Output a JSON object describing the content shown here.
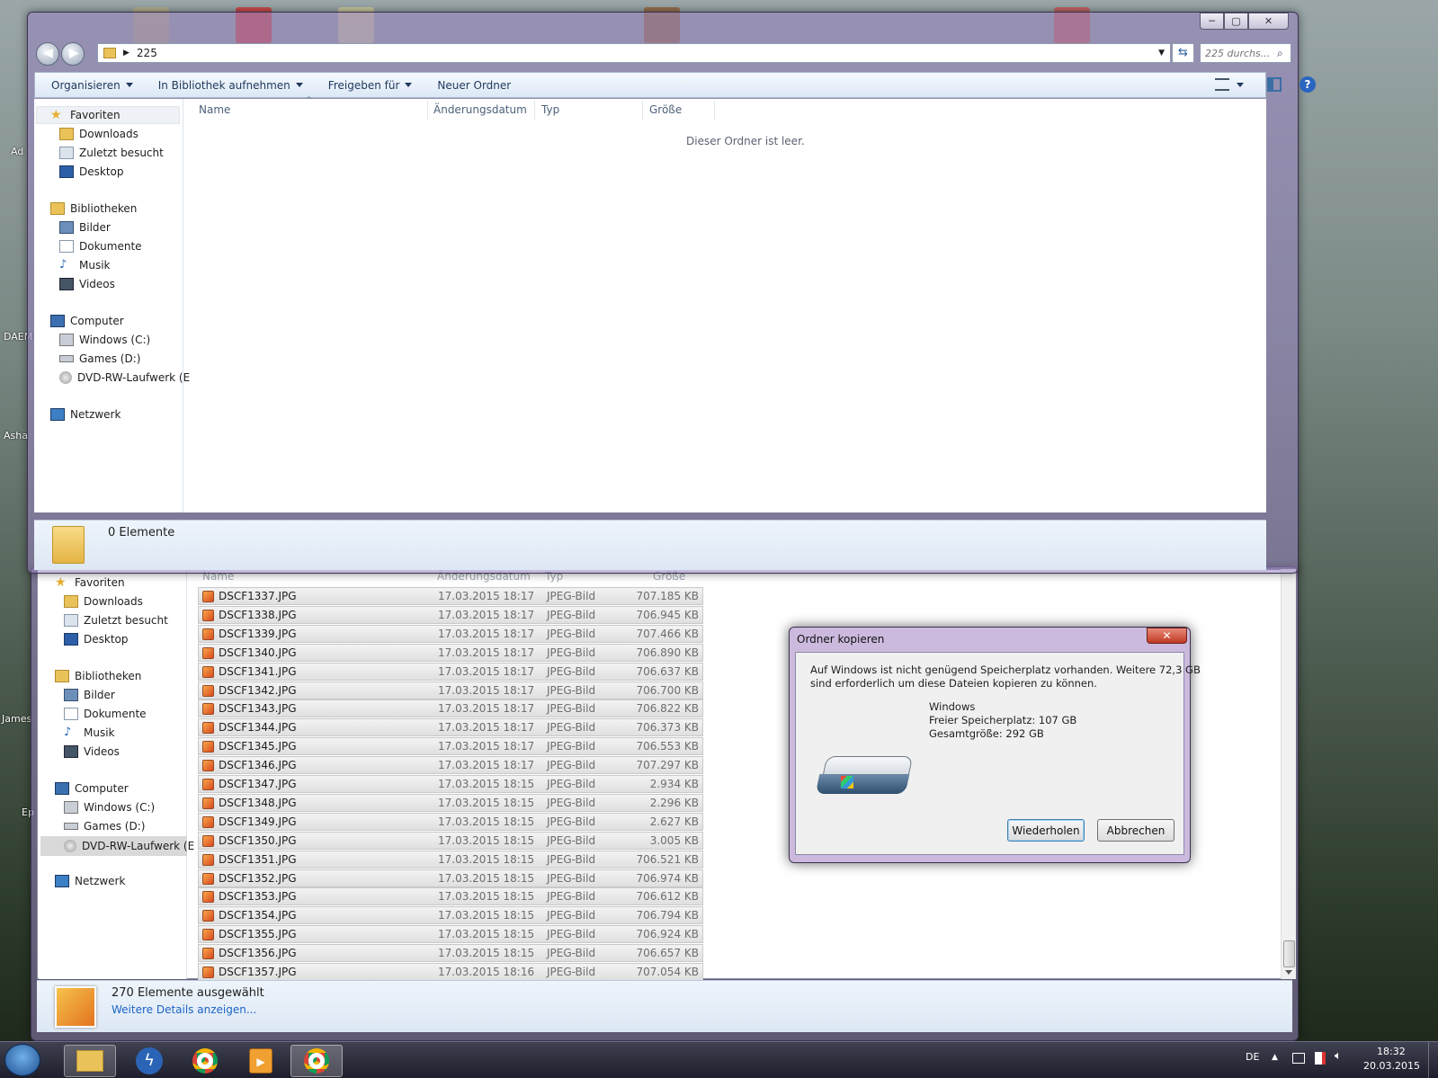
{
  "desktop": {
    "icons": [
      "Ad",
      "DAEM",
      "Asha",
      "James",
      "Ep"
    ]
  },
  "top_window": {
    "breadcrumb": "225",
    "search_placeholder": "225 durchs...",
    "toolbar": {
      "organize": "Organisieren",
      "library": "In Bibliothek aufnehmen",
      "share": "Freigeben für",
      "new_folder": "Neuer Ordner"
    },
    "columns": {
      "name": "Name",
      "date": "Änderungsdatum",
      "type": "Typ",
      "size": "Größe"
    },
    "empty_message": "Dieser Ordner ist leer.",
    "status": "0 Elemente"
  },
  "nav": {
    "favorites": "Favoriten",
    "downloads": "Downloads",
    "recent": "Zuletzt besucht",
    "desktop": "Desktop",
    "libraries": "Bibliotheken",
    "pictures": "Bilder",
    "documents": "Dokumente",
    "music": "Musik",
    "videos": "Videos",
    "computer": "Computer",
    "drive_c": "Windows (C:)",
    "drive_d": "Games (D:)",
    "drive_e": "DVD-RW-Laufwerk (E",
    "network": "Netzwerk"
  },
  "bottom_window": {
    "columns": {
      "name": "Name",
      "date": "Änderungsdatum",
      "type": "Typ",
      "size": "Größe"
    },
    "files": [
      {
        "name": "DSCF1337.JPG",
        "date": "17.03.2015 18:17",
        "type": "JPEG-Bild",
        "size": "707.185 KB"
      },
      {
        "name": "DSCF1338.JPG",
        "date": "17.03.2015 18:17",
        "type": "JPEG-Bild",
        "size": "706.945 KB"
      },
      {
        "name": "DSCF1339.JPG",
        "date": "17.03.2015 18:17",
        "type": "JPEG-Bild",
        "size": "707.466 KB"
      },
      {
        "name": "DSCF1340.JPG",
        "date": "17.03.2015 18:17",
        "type": "JPEG-Bild",
        "size": "706.890 KB"
      },
      {
        "name": "DSCF1341.JPG",
        "date": "17.03.2015 18:17",
        "type": "JPEG-Bild",
        "size": "706.637 KB"
      },
      {
        "name": "DSCF1342.JPG",
        "date": "17.03.2015 18:17",
        "type": "JPEG-Bild",
        "size": "706.700 KB"
      },
      {
        "name": "DSCF1343.JPG",
        "date": "17.03.2015 18:17",
        "type": "JPEG-Bild",
        "size": "706.822 KB"
      },
      {
        "name": "DSCF1344.JPG",
        "date": "17.03.2015 18:17",
        "type": "JPEG-Bild",
        "size": "706.373 KB"
      },
      {
        "name": "DSCF1345.JPG",
        "date": "17.03.2015 18:17",
        "type": "JPEG-Bild",
        "size": "706.553 KB"
      },
      {
        "name": "DSCF1346.JPG",
        "date": "17.03.2015 18:17",
        "type": "JPEG-Bild",
        "size": "707.297 KB"
      },
      {
        "name": "DSCF1347.JPG",
        "date": "17.03.2015 18:15",
        "type": "JPEG-Bild",
        "size": "2.934 KB"
      },
      {
        "name": "DSCF1348.JPG",
        "date": "17.03.2015 18:15",
        "type": "JPEG-Bild",
        "size": "2.296 KB"
      },
      {
        "name": "DSCF1349.JPG",
        "date": "17.03.2015 18:15",
        "type": "JPEG-Bild",
        "size": "2.627 KB"
      },
      {
        "name": "DSCF1350.JPG",
        "date": "17.03.2015 18:15",
        "type": "JPEG-Bild",
        "size": "3.005 KB"
      },
      {
        "name": "DSCF1351.JPG",
        "date": "17.03.2015 18:15",
        "type": "JPEG-Bild",
        "size": "706.521 KB"
      },
      {
        "name": "DSCF1352.JPG",
        "date": "17.03.2015 18:15",
        "type": "JPEG-Bild",
        "size": "706.974 KB"
      },
      {
        "name": "DSCF1353.JPG",
        "date": "17.03.2015 18:15",
        "type": "JPEG-Bild",
        "size": "706.612 KB"
      },
      {
        "name": "DSCF1354.JPG",
        "date": "17.03.2015 18:15",
        "type": "JPEG-Bild",
        "size": "706.794 KB"
      },
      {
        "name": "DSCF1355.JPG",
        "date": "17.03.2015 18:15",
        "type": "JPEG-Bild",
        "size": "706.924 KB"
      },
      {
        "name": "DSCF1356.JPG",
        "date": "17.03.2015 18:15",
        "type": "JPEG-Bild",
        "size": "706.657 KB"
      },
      {
        "name": "DSCF1357.JPG",
        "date": "17.03.2015 18:16",
        "type": "JPEG-Bild",
        "size": "707.054 KB"
      }
    ],
    "status_selected": "270 Elemente ausgewählt",
    "status_details": "Weitere Details anzeigen..."
  },
  "dialog": {
    "title": "Ordner kopieren",
    "message_line1": "Auf Windows ist nicht genügend Speicherplatz vorhanden. Weitere 72,3 GB",
    "message_line2": "sind erforderlich um diese Dateien kopieren zu können.",
    "drive_name": "Windows",
    "free_space": "Freier Speicherplatz: 107 GB",
    "total_size": "Gesamtgröße: 292 GB",
    "retry": "Wiederholen",
    "cancel": "Abbrechen"
  },
  "taskbar": {
    "language": "DE",
    "time": "18:32",
    "date": "20.03.2015"
  }
}
